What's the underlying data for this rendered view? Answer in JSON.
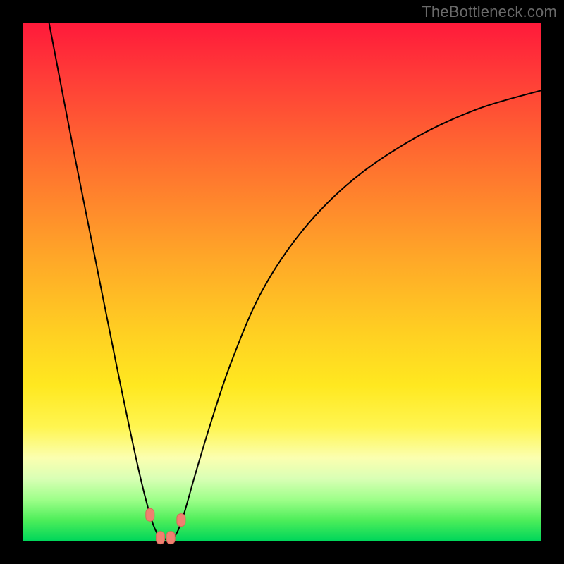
{
  "watermark": "TheBottleneck.com",
  "chart_data": {
    "type": "line",
    "title": "",
    "xlabel": "",
    "ylabel": "",
    "xlim": [
      0,
      1
    ],
    "ylim": [
      0,
      1
    ],
    "background_gradient": {
      "top": "#ff1a3a",
      "bottom": "#00d65a"
    },
    "series": [
      {
        "name": "curve",
        "x": [
          0.05,
          0.1,
          0.14,
          0.18,
          0.22,
          0.245,
          0.26,
          0.27,
          0.28,
          0.295,
          0.31,
          0.33,
          0.36,
          0.4,
          0.46,
          0.54,
          0.64,
          0.76,
          0.88,
          1.0
        ],
        "y": [
          1.0,
          0.74,
          0.54,
          0.34,
          0.15,
          0.05,
          0.012,
          0.004,
          0.004,
          0.012,
          0.05,
          0.12,
          0.22,
          0.34,
          0.48,
          0.6,
          0.7,
          0.78,
          0.835,
          0.87
        ]
      }
    ],
    "markers": [
      {
        "x": 0.245,
        "y": 0.05
      },
      {
        "x": 0.265,
        "y": 0.006
      },
      {
        "x": 0.285,
        "y": 0.006
      },
      {
        "x": 0.305,
        "y": 0.04
      }
    ]
  }
}
